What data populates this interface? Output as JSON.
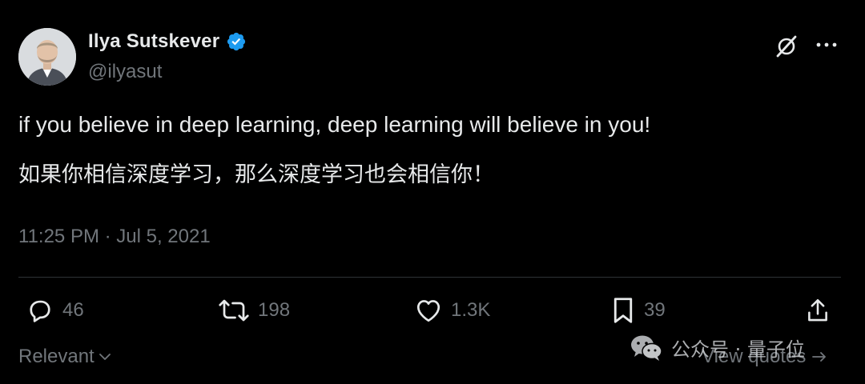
{
  "author": {
    "display_name": "Ilya Sutskever",
    "handle": "@ilyasut",
    "verified": true
  },
  "header_icons": {
    "grok": "x-slash-icon",
    "more": "more-icon"
  },
  "tweet": {
    "text_en": "if you believe in deep learning, deep learning will believe in you!",
    "text_zh": "如果你相信深度学习，那么深度学习也会相信你！",
    "timestamp": "11:25 PM · Jul 5, 2021"
  },
  "actions": {
    "replies": "46",
    "retweets": "198",
    "likes": "1.3K",
    "bookmarks": "39"
  },
  "footer": {
    "sort_label": "Relevant",
    "view_quotes_label": "View quotes"
  },
  "watermark": {
    "text": "公众号 · 量子位"
  },
  "colors": {
    "background": "#000000",
    "text_primary": "#e7e9ea",
    "text_secondary": "#71767b",
    "divider": "#2f3336",
    "verified": "#1d9bf0"
  }
}
